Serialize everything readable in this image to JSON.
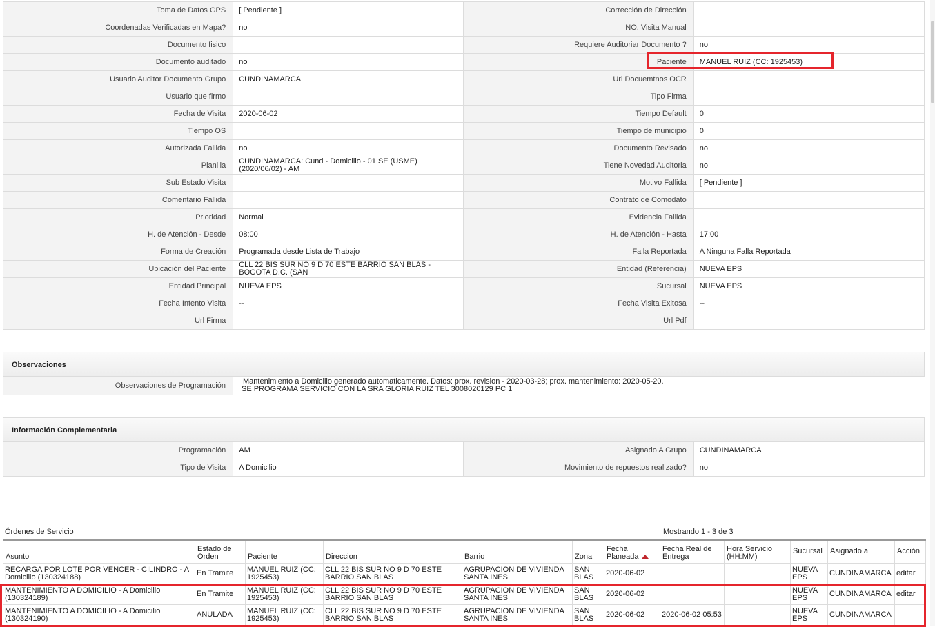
{
  "details": {
    "rows": [
      [
        "Toma de Datos GPS",
        "[ Pendiente ]",
        "Corrección de Dirección",
        ""
      ],
      [
        "Coordenadas Verificadas en Mapa?",
        "no",
        "NO. Visita Manual",
        ""
      ],
      [
        "Documento fisico",
        "",
        "Requiere Auditoriar Documento ?",
        "no"
      ],
      [
        "Documento auditado",
        "no",
        "Paciente",
        "MANUEL RUIZ (CC: 1925453)"
      ],
      [
        "Usuario Auditor Documento Grupo",
        "CUNDINAMARCA",
        "Url Docuemtnos OCR",
        ""
      ],
      [
        "Usuario que firmo",
        "",
        "Tipo Firma",
        ""
      ],
      [
        "Fecha de Visita",
        "2020-06-02",
        "Tiempo Default",
        "0"
      ],
      [
        "Tiempo OS",
        "",
        "Tiempo de municipio",
        "0"
      ],
      [
        "Autorizada Fallida",
        "no",
        "Documento Revisado",
        "no"
      ],
      [
        "Planilla",
        "CUNDINAMARCA: Cund - Domicilio - 01 SE (USME) (2020/06/02) - AM",
        "Tiene Novedad Auditoria",
        "no"
      ],
      [
        "Sub Estado Visita",
        "",
        "Motivo Fallida",
        "[ Pendiente ]"
      ],
      [
        "Comentario Fallida",
        "",
        "Contrato de Comodato",
        ""
      ],
      [
        "Prioridad",
        "Normal",
        "Evidencia Fallida",
        ""
      ],
      [
        "H. de Atención - Desde",
        "08:00",
        "H. de Atención - Hasta",
        "17:00"
      ],
      [
        "Forma de Creación",
        "Programada desde Lista de Trabajo",
        "Falla Reportada",
        "A Ninguna Falla Reportada"
      ],
      [
        "Ubicación del Paciente",
        "CLL 22 BIS SUR NO 9 D 70 ESTE BARRIO SAN BLAS - BOGOTA D.C. (SAN",
        "Entidad (Referencia)",
        "NUEVA EPS"
      ],
      [
        "Entidad Principal",
        "NUEVA EPS",
        "Sucursal",
        "NUEVA EPS"
      ],
      [
        "Fecha Intento Visita",
        "--",
        "Fecha Visita Exitosa",
        "--"
      ],
      [
        "Url Firma",
        "",
        "Url Pdf",
        ""
      ]
    ]
  },
  "observaciones": {
    "title": "Observaciones",
    "label": "Observaciones de Programación",
    "line1": "Mantenimiento a Domicilio generado automaticamente. Datos: prox. revision - 2020-03-28; prox. mantenimiento: 2020-05-20.",
    "line2": "SE PROGRAMA SERVICIO CON LA SRA GLORIA RUIZ TEL 3008020129 PC 1"
  },
  "complementaria": {
    "title": "Información Complementaria",
    "rows": [
      [
        "Programación",
        "AM",
        "Asignado A Grupo",
        "CUNDINAMARCA"
      ],
      [
        "Tipo de Visita",
        "A Domicilio",
        "Movimiento de repuestos realizado?",
        "no"
      ]
    ]
  },
  "ordenes": {
    "title": "Órdenes de Servicio",
    "count": "Mostrando 1 - 3 de 3",
    "headers": [
      "Asunto",
      "Estado de Orden",
      "Paciente",
      "Direccion",
      "Barrio",
      "Zona",
      "Fecha Planeada",
      "Fecha Real de Entrega",
      "Hora Servicio (HH:MM)",
      "Sucursal",
      "Asignado a",
      "Acción"
    ],
    "rows": [
      [
        "RECARGA POR LOTE POR VENCER - CILINDRO - A Domicilio (130324188)",
        "En Tramite",
        "MANUEL RUIZ (CC: 1925453)",
        "CLL 22 BIS SUR NO 9 D 70 ESTE BARRIO SAN BLAS",
        "AGRUPACION DE VIVIENDA SANTA INES",
        "SAN BLAS",
        "2020-06-02",
        "",
        "",
        "NUEVA EPS",
        "CUNDINAMARCA",
        "editar"
      ],
      [
        "MANTENIMIENTO A DOMICILIO - A Domicilio (130324189)",
        "En Tramite",
        "MANUEL RUIZ (CC: 1925453)",
        "CLL 22 BIS SUR NO 9 D 70 ESTE BARRIO SAN BLAS",
        "AGRUPACION DE VIVIENDA SANTA INES",
        "SAN BLAS",
        "2020-06-02",
        "",
        "",
        "NUEVA EPS",
        "CUNDINAMARCA",
        "editar"
      ],
      [
        "MANTENIMIENTO A DOMICILIO - A Domicilio (130324190)",
        "ANULADA",
        "MANUEL RUIZ (CC: 1925453)",
        "CLL 22 BIS SUR NO 9 D 70 ESTE BARRIO SAN BLAS",
        "AGRUPACION DE VIVIENDA SANTA INES",
        "SAN BLAS",
        "2020-06-02",
        "2020-06-02 05:53",
        "",
        "NUEVA EPS",
        "CUNDINAMARCA",
        ""
      ]
    ]
  },
  "colors": {
    "highlight": "#e5252c",
    "sort_arrow": "#c0272d"
  }
}
